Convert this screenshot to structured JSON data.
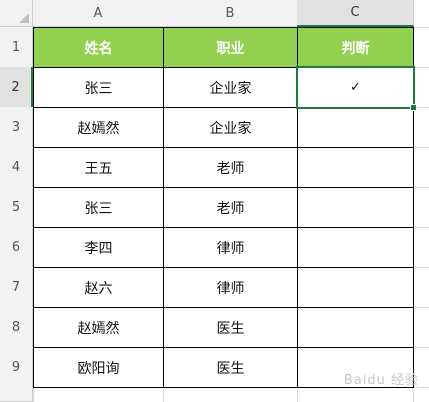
{
  "columns": [
    "A",
    "B",
    "C"
  ],
  "rows": [
    "1",
    "2",
    "3",
    "4",
    "5",
    "6",
    "7",
    "8",
    "9"
  ],
  "header": {
    "name": "姓名",
    "job": "职业",
    "judge": "判断"
  },
  "data_rows": [
    {
      "name": "张三",
      "job": "企业家",
      "judge": "✓"
    },
    {
      "name": "赵嫣然",
      "job": "企业家",
      "judge": ""
    },
    {
      "name": "王五",
      "job": "老师",
      "judge": ""
    },
    {
      "name": "张三",
      "job": "老师",
      "judge": ""
    },
    {
      "name": "李四",
      "job": "律师",
      "judge": ""
    },
    {
      "name": "赵六",
      "job": "律师",
      "judge": ""
    },
    {
      "name": "赵嫣然",
      "job": "医生",
      "judge": ""
    },
    {
      "name": "欧阳询",
      "job": "医生",
      "judge": ""
    }
  ],
  "selected_cell": "C2",
  "header_fill": "#92d050",
  "selection_color": "#1f7a3b",
  "watermark": "Baidu 经验"
}
